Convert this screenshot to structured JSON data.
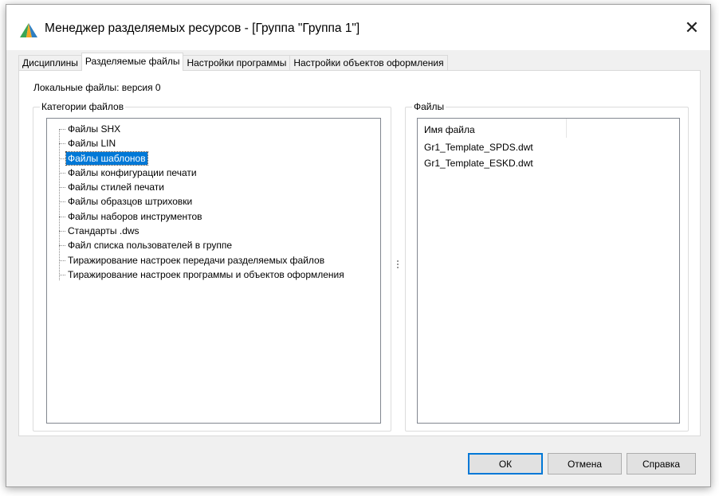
{
  "window": {
    "title": "Менеджер разделяемых ресурсов - [Группа \"Группа 1\"]",
    "close_glyph": "✕"
  },
  "tabs": [
    {
      "label": "Дисциплины"
    },
    {
      "label": "Разделяемые файлы",
      "active": true
    },
    {
      "label": "Настройки программы"
    },
    {
      "label": "Настройки объектов оформления"
    }
  ],
  "panel": {
    "local_files_label": "Локальные файлы: версия 0",
    "categories": {
      "title": "Категории файлов",
      "items": [
        "Файлы SHX",
        "Файлы LIN",
        "Файлы шаблонов",
        "Файлы конфигурации печати",
        "Файлы стилей печати",
        "Файлы образцов штриховки",
        "Файлы наборов инструментов",
        "Стандарты .dws",
        "Файл списка пользователей в группе",
        "Тиражирование настроек передачи разделяемых файлов",
        "Тиражирование настроек программы и объектов оформления"
      ],
      "selected_index": 2
    },
    "files": {
      "title": "Файлы",
      "column_header": "Имя файла",
      "rows": [
        "Gr1_Template_SPDS.dwt",
        "Gr1_Template_ESKD.dwt"
      ]
    }
  },
  "buttons": {
    "ok": "ОК",
    "cancel": "Отмена",
    "help": "Справка"
  },
  "colors": {
    "selection": "#0078d7",
    "default_button_border": "#0078d7"
  },
  "icons": {
    "app": "pyramid-app-icon",
    "close": "close-icon"
  }
}
